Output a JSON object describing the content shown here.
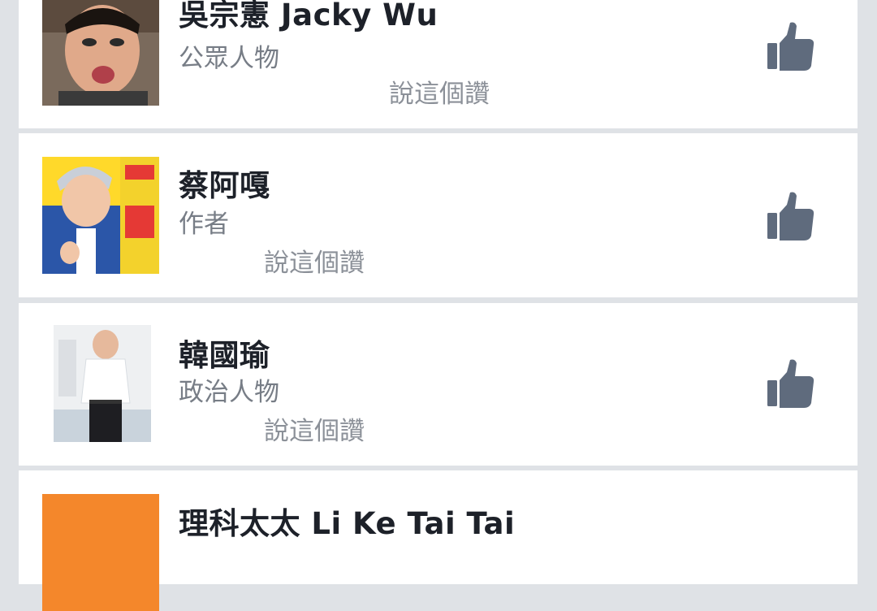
{
  "pages": [
    {
      "name": "吳宗憲 Jacky Wu",
      "category": "公眾人物",
      "likes_text": "說這個讚",
      "avatar": "portrait-photo-jacky-wu"
    },
    {
      "name": "蔡阿嘎",
      "category": "作者",
      "likes_text": "說這個讚",
      "avatar": "portrait-photo-tsai-a-ga"
    },
    {
      "name": "韓國瑜",
      "category": "政治人物",
      "likes_text": "說這個讚",
      "avatar": "portrait-photo-han-kuo-yu"
    },
    {
      "name": "理科太太 Li Ke Tai Tai",
      "avatar": "orange-avatar"
    }
  ],
  "icons": {
    "like": "thumbs-up-icon"
  },
  "colors": {
    "background": "#dfe2e6",
    "card": "#ffffff",
    "name_text": "#1d2129",
    "secondary_text": "#777d86",
    "like_icon": "#5f6b7d",
    "orange_avatar": "#f4872b"
  }
}
